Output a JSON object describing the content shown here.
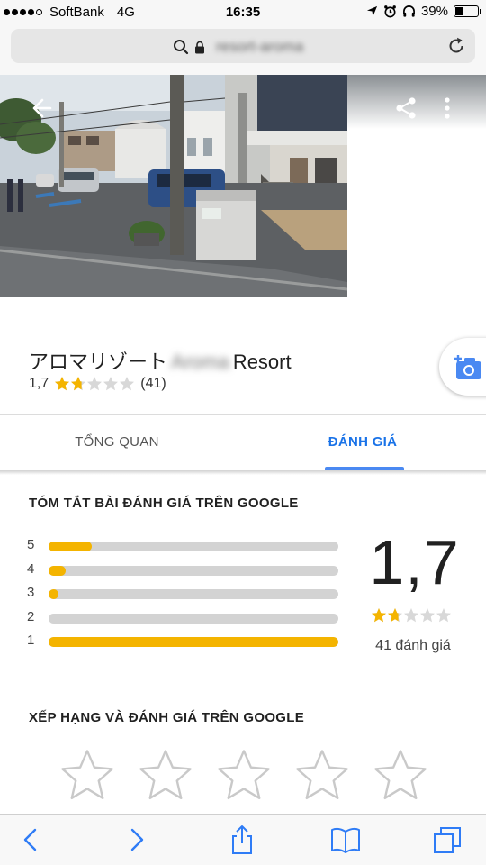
{
  "status_bar": {
    "carrier": "SoftBank",
    "network": "4G",
    "time": "16:35",
    "battery": "39%",
    "battery_level": 0.39,
    "signal_bars_filled": 4
  },
  "browser": {
    "url": "resort-aroma",
    "url_blurred": true
  },
  "place": {
    "name_prefix": "アロマリゾート",
    "name_blurred": "Aroma",
    "name_suffix": "Resort",
    "rating": "1,7",
    "rating_value": 1.7,
    "review_count": "(41)"
  },
  "tabs": {
    "overview": "TỔNG QUAN",
    "reviews": "ĐÁNH GIÁ",
    "active": "reviews"
  },
  "summary": {
    "heading": "TÓM TẮT BÀI ĐÁNH GIÁ TRÊN GOOGLE",
    "big_rating": "1,7",
    "review_count_text": "41 đánh giá",
    "histogram": [
      {
        "stars": "5",
        "fraction": 0.15
      },
      {
        "stars": "4",
        "fraction": 0.06
      },
      {
        "stars": "3",
        "fraction": 0.03
      },
      {
        "stars": "2",
        "fraction": 0.0
      },
      {
        "stars": "1",
        "fraction": 1.0
      }
    ]
  },
  "rate_section": {
    "heading": "XẾP HẠNG VÀ ĐÁNH GIÁ TRÊN GOOGLE",
    "star_count": 5
  },
  "colors": {
    "accent_blue": "#1a73e8",
    "star_gold": "#f4b400",
    "star_empty": "#d8d8d8",
    "bar_track": "#d3d3d3"
  },
  "icons": {
    "back": "arrow-left-icon",
    "share": "share-icon",
    "more": "more-vert-icon",
    "add_photo": "add-photo-icon",
    "search": "search-icon",
    "lock": "lock-icon",
    "reload": "reload-icon"
  }
}
